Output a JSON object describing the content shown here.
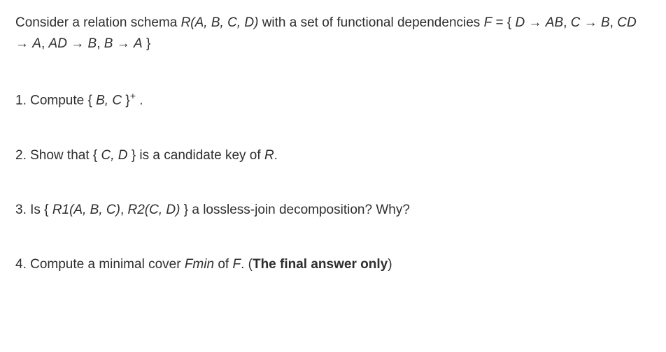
{
  "intro": {
    "text_before_schema": "Consider a relation schema ",
    "schema": "R(A, B, C, D)",
    "text_after_schema": " with a set of functional dependencies ",
    "fd_label": "F",
    "equals": " = { ",
    "fd1_left": "D",
    "arrow": " → ",
    "fd1_right": "AB",
    "sep": ", ",
    "fd2_left": "C",
    "fd2_right": "B",
    "fd3_left": "CD",
    "fd3_right": "A",
    "fd4_left": "AD",
    "fd4_right": "B",
    "fd5_left": "B",
    "fd5_right": "A",
    "close": " }"
  },
  "q1": {
    "num": "1. ",
    "text_before": "Compute { ",
    "set": "B, C",
    "text_after": " }",
    "super": "+",
    "period": " ."
  },
  "q2": {
    "num": "2. ",
    "text_before": "Show that { ",
    "set": "C, D",
    "text_mid": " } is a candidate key of ",
    "rel": "R",
    "period": "."
  },
  "q3": {
    "num": "3. ",
    "text_before": "Is { ",
    "r1": "R1(A, B, C)",
    "sep": ", ",
    "r2": "R2(C, D)",
    "text_after": " } a lossless-join decomposition? Why?"
  },
  "q4": {
    "num": "4. ",
    "text_before": "Compute a minimal cover ",
    "fmin": "Fmin",
    "text_mid": " of ",
    "f": "F",
    "period": ". (",
    "bold_text": "The final answer only",
    "close": ")"
  }
}
